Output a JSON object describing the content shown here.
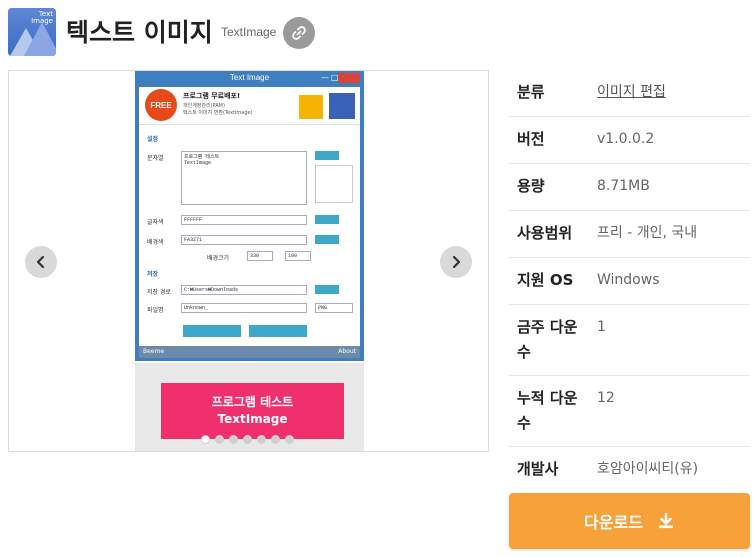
{
  "header": {
    "title": "텍스트 이미지",
    "subtitle": "TextImage",
    "app_icon_text": "Text Image",
    "link_icon": "link-icon"
  },
  "gallery": {
    "prev_icon": "chevron-left-icon",
    "next_icon": "chevron-right-icon",
    "dot_count": 7,
    "active_dot": 1,
    "screenshot": {
      "window_title": "Text Image",
      "banner_free": "FREE",
      "banner_line1": "프로그램 무료배포!",
      "banner_line2": "개인계정관리(PAM)",
      "banner_line3": "텍스트 이미지 변환(Textimage)",
      "section_settings": "설정",
      "label_text": "문자열",
      "text_value_1": "프로그램 테스트",
      "text_value_2": "TextImage",
      "label_font_color": "글자색",
      "font_color_value": "FFFFFF",
      "label_bg_color": "배경색",
      "bg_color_value": "FA3271",
      "label_bg_size": "배경크기",
      "bg_size_w": "330",
      "bg_size_h": "100",
      "section_save": "저장",
      "label_save_path": "저장 경로",
      "save_path_value": "C:₩Users₩Downloads",
      "label_file_name": "파일명",
      "file_name_value": "Unknown_",
      "file_type_value": "PNG",
      "footer_left": "Beeme",
      "footer_right": "About"
    },
    "promo": {
      "line1": "프로그램 테스트",
      "line2": "TextImage"
    }
  },
  "info": {
    "rows": [
      {
        "label": "분류",
        "value": "이미지 편집"
      },
      {
        "label": "버전",
        "value": "v1.0.0.2"
      },
      {
        "label": "용량",
        "value": "8.71MB"
      },
      {
        "label": "사용범위",
        "value": "프리 - 개인, 국내"
      },
      {
        "label": "지원 OS",
        "value": "Windows"
      },
      {
        "label": "금주 다운수",
        "label_line1": "금주 다운",
        "label_line2": "수",
        "value": "1"
      },
      {
        "label": "누적 다운수",
        "label_line1": "누적 다운",
        "label_line2": "수",
        "value": "12"
      },
      {
        "label": "개발사",
        "value": "호암아이씨티(유)"
      }
    ]
  },
  "download": {
    "label": "다운로드",
    "icon": "download-icon"
  },
  "colors": {
    "download_bg": "#f7a13a",
    "promo_bg": "#f0306d",
    "window_blue": "#3f7fbf"
  }
}
